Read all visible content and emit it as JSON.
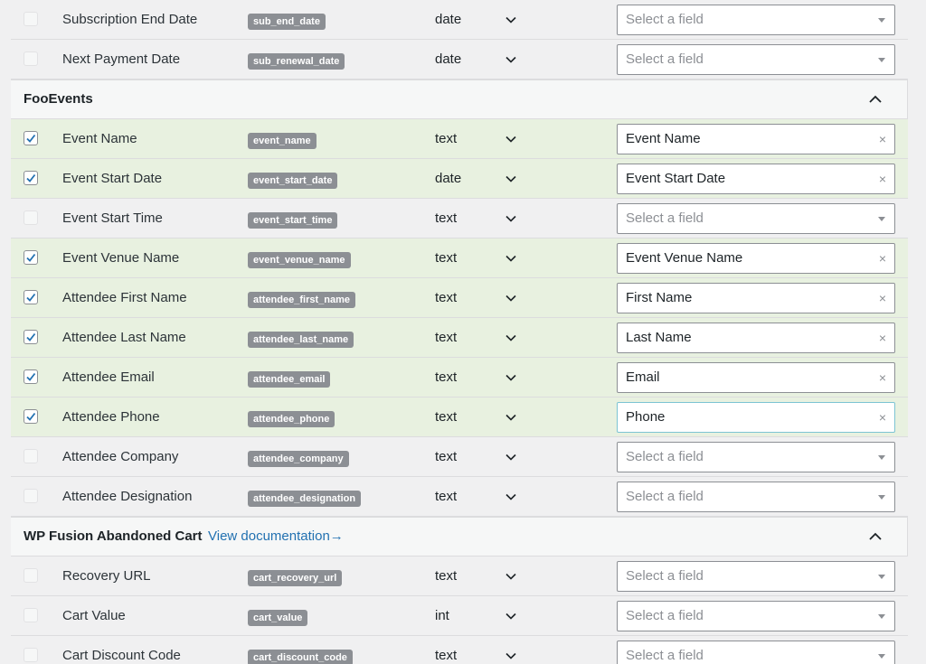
{
  "rows_top": [
    {
      "label": "Subscription End Date",
      "key": "sub_end_date",
      "type": "date",
      "checked": false,
      "value": "",
      "placeholder": "Select a field"
    },
    {
      "label": "Next Payment Date",
      "key": "sub_renewal_date",
      "type": "date",
      "checked": false,
      "value": "",
      "placeholder": "Select a field"
    }
  ],
  "section_fooevents": {
    "title": "FooEvents",
    "toggle_icon": "chevron-up-icon"
  },
  "rows_fooevents": [
    {
      "label": "Event Name",
      "key": "event_name",
      "type": "text",
      "checked": true,
      "value": "Event Name",
      "placeholder": "Select a field"
    },
    {
      "label": "Event Start Date",
      "key": "event_start_date",
      "type": "date",
      "checked": true,
      "value": "Event Start Date",
      "placeholder": "Select a field"
    },
    {
      "label": "Event Start Time",
      "key": "event_start_time",
      "type": "text",
      "checked": false,
      "value": "",
      "placeholder": "Select a field"
    },
    {
      "label": "Event Venue Name",
      "key": "event_venue_name",
      "type": "text",
      "checked": true,
      "value": "Event Venue Name",
      "placeholder": "Select a field"
    },
    {
      "label": "Attendee First Name",
      "key": "attendee_first_name",
      "type": "text",
      "checked": true,
      "value": "First Name",
      "placeholder": "Select a field"
    },
    {
      "label": "Attendee Last Name",
      "key": "attendee_last_name",
      "type": "text",
      "checked": true,
      "value": "Last Name",
      "placeholder": "Select a field"
    },
    {
      "label": "Attendee Email",
      "key": "attendee_email",
      "type": "text",
      "checked": true,
      "value": "Email",
      "placeholder": "Select a field"
    },
    {
      "label": "Attendee Phone",
      "key": "attendee_phone",
      "type": "text",
      "checked": true,
      "value": "Phone",
      "placeholder": "Select a field",
      "focused": true
    },
    {
      "label": "Attendee Company",
      "key": "attendee_company",
      "type": "text",
      "checked": false,
      "value": "",
      "placeholder": "Select a field"
    },
    {
      "label": "Attendee Designation",
      "key": "attendee_designation",
      "type": "text",
      "checked": false,
      "value": "",
      "placeholder": "Select a field"
    }
  ],
  "section_cart": {
    "title": "WP Fusion Abandoned Cart",
    "link": "View documentation→",
    "toggle_icon": "chevron-up-icon"
  },
  "rows_cart": [
    {
      "label": "Recovery URL",
      "key": "cart_recovery_url",
      "type": "text",
      "checked": false,
      "value": "",
      "placeholder": "Select a field"
    },
    {
      "label": "Cart Value",
      "key": "cart_value",
      "type": "int",
      "checked": false,
      "value": "",
      "placeholder": "Select a field"
    },
    {
      "label": "Cart Discount Code",
      "key": "cart_discount_code",
      "type": "text",
      "checked": false,
      "value": "",
      "placeholder": "Select a field"
    }
  ],
  "colors": {
    "active_row": "#e8f1e0",
    "checkbox_check": "#2271b1",
    "tag_bg": "#8c8f94",
    "link": "#2271b1"
  },
  "icons": {
    "row_type_toggle": "chevron-down-icon",
    "select_open": "caret-down-icon",
    "select_clear": "clear-icon",
    "checkbox": "checkmark-icon"
  }
}
